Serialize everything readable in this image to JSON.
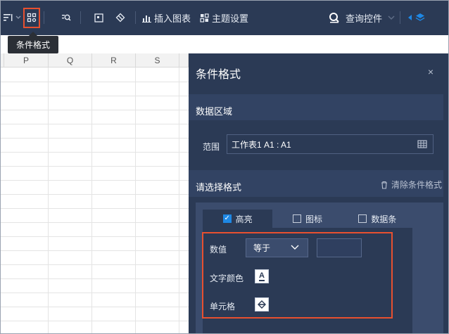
{
  "toolbar": {
    "insert_chart": "插入图表",
    "theme_settings": "主题设置",
    "query_control": "查询控件"
  },
  "tooltip": {
    "text": "条件格式"
  },
  "sheet": {
    "columns": [
      "P",
      "Q",
      "R",
      "S"
    ]
  },
  "panel": {
    "title": "条件格式",
    "close": "×",
    "data_region_label": "数据区域",
    "range_label": "范围",
    "range_value": "工作表1 A1 : A1",
    "choose_format_label": "请选择格式",
    "clear_label": "清除条件格式",
    "tabs": [
      {
        "label": "高亮",
        "checked": true
      },
      {
        "label": "图标",
        "checked": false
      },
      {
        "label": "数据条",
        "checked": false
      }
    ],
    "value_label": "数值",
    "operator_value": "等于",
    "value_input": "",
    "text_color_label": "文字颜色",
    "text_color_glyph": "A",
    "cell_label": "单元格",
    "accent_color": "#e8502f",
    "check_color": "#1e88e5"
  }
}
